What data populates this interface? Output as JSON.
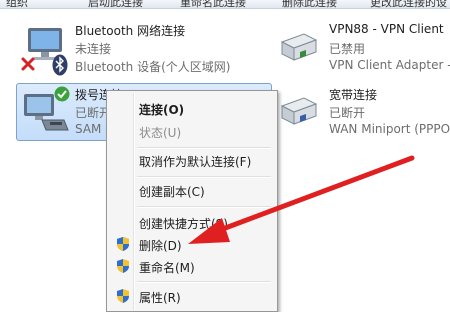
{
  "toolbar": {
    "items": [
      "组织",
      "启动此连接",
      "重命名此连接",
      "删除此连接",
      "更改此连接的设置"
    ]
  },
  "connections": [
    {
      "name": "Bluetooth 网络连接",
      "status": "未连接",
      "device": "Bluetooth 设备(个人区域网)",
      "icon": "network-computer-icon",
      "badge": "bluetooth-icon",
      "error_mark": "disconnected-x-icon"
    },
    {
      "name": "VPN88 - VPN Client",
      "status": "已禁用",
      "device": "VPN Client Adapter - ",
      "icon": "vpn-adapter-icon"
    },
    {
      "name": "拨号连接",
      "status": "已断开",
      "device": "SAM",
      "icon": "dialup-modem-icon",
      "badge": "check-icon"
    },
    {
      "name": "宽带连接",
      "status": "已断开",
      "device": "WAN Miniport (PPPO",
      "icon": "broadband-adapter-icon"
    }
  ],
  "context_menu": {
    "items": [
      {
        "label": "连接(O)",
        "bold": true,
        "disabled": false,
        "shield": false
      },
      {
        "label": "状态(U)",
        "bold": false,
        "disabled": true,
        "shield": false
      },
      {
        "label": "取消作为默认连接(F)",
        "bold": false,
        "disabled": false,
        "shield": false
      },
      {
        "label": "创建副本(C)",
        "bold": false,
        "disabled": false,
        "shield": false
      },
      {
        "label": "创建快捷方式(S)",
        "bold": false,
        "disabled": false,
        "shield": false
      },
      {
        "label": "删除(D)",
        "bold": false,
        "disabled": false,
        "shield": true
      },
      {
        "label": "重命名(M)",
        "bold": false,
        "disabled": false,
        "shield": true
      },
      {
        "label": "属性(R)",
        "bold": false,
        "disabled": false,
        "shield": true
      }
    ]
  },
  "annotation": {
    "color": "#e02020",
    "icon": "red-arrow-annotation"
  }
}
